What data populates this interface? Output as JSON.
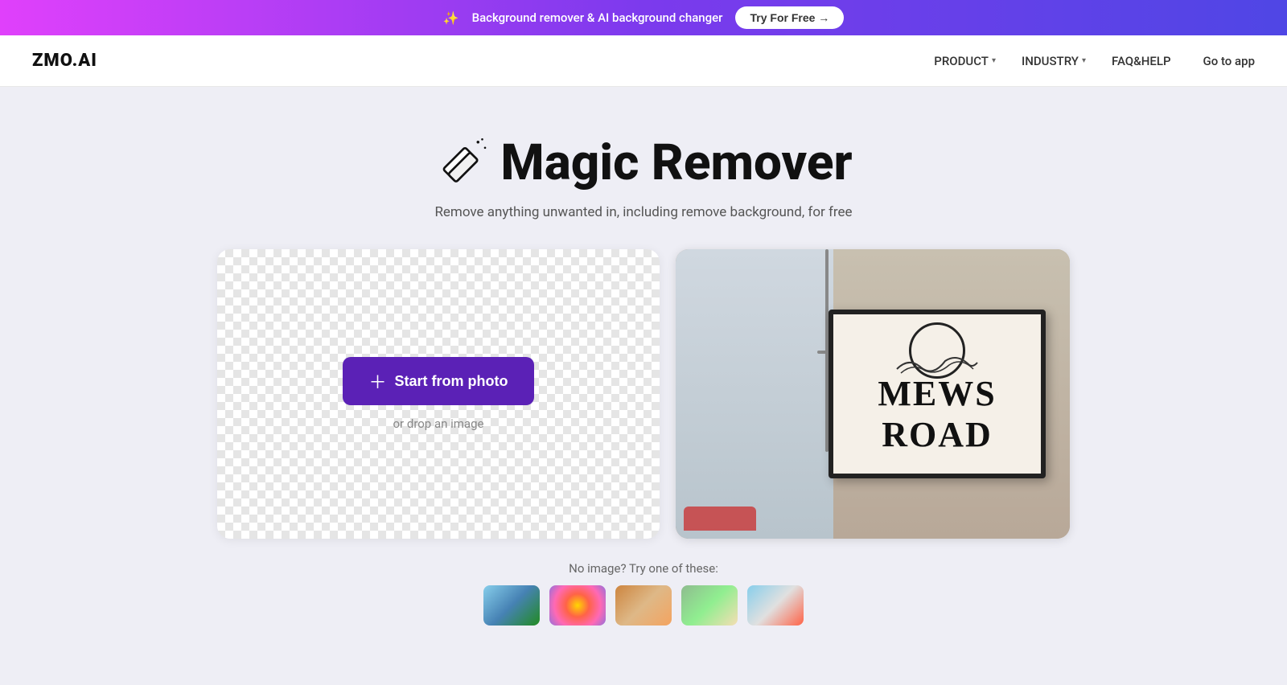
{
  "banner": {
    "sparkle": "✨",
    "text": "Background remover & AI background changer",
    "btn_label": "Try For Free →"
  },
  "nav": {
    "logo": "ZMO.AI",
    "links": [
      {
        "label": "PRODUCT",
        "has_dropdown": true
      },
      {
        "label": "INDUSTRY",
        "has_dropdown": true
      },
      {
        "label": "FAQ&HELP",
        "has_dropdown": false
      }
    ],
    "goto_label": "Go to app"
  },
  "hero": {
    "title": "Magic Remover",
    "subtitle": "Remove anything unwanted in, including remove background, for free"
  },
  "upload": {
    "start_btn_label": "Start from photo",
    "drop_label": "or drop an image"
  },
  "samples": {
    "label": "No image? Try one of these:"
  }
}
